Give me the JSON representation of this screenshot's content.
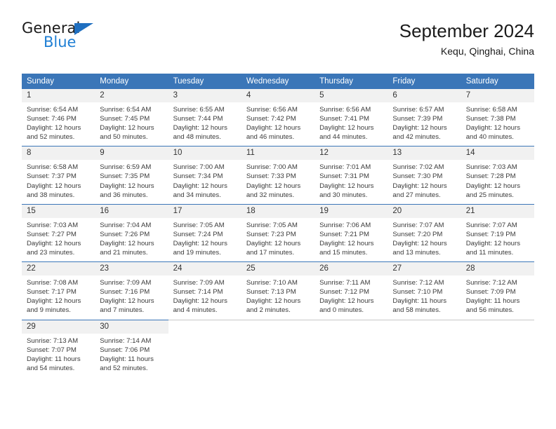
{
  "brand": {
    "name_primary": "General",
    "name_secondary": "Blue",
    "accent_color": "#1f7fd4",
    "triangle_color": "#1f6fc0"
  },
  "header": {
    "title": "September 2024",
    "subtitle": "Kequ, Qinghai, China"
  },
  "calendar": {
    "header_bg": "#3b76b8",
    "daynum_bg": "#f1f1f1",
    "weekday_headers": [
      "Sunday",
      "Monday",
      "Tuesday",
      "Wednesday",
      "Thursday",
      "Friday",
      "Saturday"
    ],
    "weeks": [
      [
        {
          "day": "1",
          "sunrise": "Sunrise: 6:54 AM",
          "sunset": "Sunset: 7:46 PM",
          "daylight_line1": "Daylight: 12 hours",
          "daylight_line2": "and 52 minutes."
        },
        {
          "day": "2",
          "sunrise": "Sunrise: 6:54 AM",
          "sunset": "Sunset: 7:45 PM",
          "daylight_line1": "Daylight: 12 hours",
          "daylight_line2": "and 50 minutes."
        },
        {
          "day": "3",
          "sunrise": "Sunrise: 6:55 AM",
          "sunset": "Sunset: 7:44 PM",
          "daylight_line1": "Daylight: 12 hours",
          "daylight_line2": "and 48 minutes."
        },
        {
          "day": "4",
          "sunrise": "Sunrise: 6:56 AM",
          "sunset": "Sunset: 7:42 PM",
          "daylight_line1": "Daylight: 12 hours",
          "daylight_line2": "and 46 minutes."
        },
        {
          "day": "5",
          "sunrise": "Sunrise: 6:56 AM",
          "sunset": "Sunset: 7:41 PM",
          "daylight_line1": "Daylight: 12 hours",
          "daylight_line2": "and 44 minutes."
        },
        {
          "day": "6",
          "sunrise": "Sunrise: 6:57 AM",
          "sunset": "Sunset: 7:39 PM",
          "daylight_line1": "Daylight: 12 hours",
          "daylight_line2": "and 42 minutes."
        },
        {
          "day": "7",
          "sunrise": "Sunrise: 6:58 AM",
          "sunset": "Sunset: 7:38 PM",
          "daylight_line1": "Daylight: 12 hours",
          "daylight_line2": "and 40 minutes."
        }
      ],
      [
        {
          "day": "8",
          "sunrise": "Sunrise: 6:58 AM",
          "sunset": "Sunset: 7:37 PM",
          "daylight_line1": "Daylight: 12 hours",
          "daylight_line2": "and 38 minutes."
        },
        {
          "day": "9",
          "sunrise": "Sunrise: 6:59 AM",
          "sunset": "Sunset: 7:35 PM",
          "daylight_line1": "Daylight: 12 hours",
          "daylight_line2": "and 36 minutes."
        },
        {
          "day": "10",
          "sunrise": "Sunrise: 7:00 AM",
          "sunset": "Sunset: 7:34 PM",
          "daylight_line1": "Daylight: 12 hours",
          "daylight_line2": "and 34 minutes."
        },
        {
          "day": "11",
          "sunrise": "Sunrise: 7:00 AM",
          "sunset": "Sunset: 7:33 PM",
          "daylight_line1": "Daylight: 12 hours",
          "daylight_line2": "and 32 minutes."
        },
        {
          "day": "12",
          "sunrise": "Sunrise: 7:01 AM",
          "sunset": "Sunset: 7:31 PM",
          "daylight_line1": "Daylight: 12 hours",
          "daylight_line2": "and 30 minutes."
        },
        {
          "day": "13",
          "sunrise": "Sunrise: 7:02 AM",
          "sunset": "Sunset: 7:30 PM",
          "daylight_line1": "Daylight: 12 hours",
          "daylight_line2": "and 27 minutes."
        },
        {
          "day": "14",
          "sunrise": "Sunrise: 7:03 AM",
          "sunset": "Sunset: 7:28 PM",
          "daylight_line1": "Daylight: 12 hours",
          "daylight_line2": "and 25 minutes."
        }
      ],
      [
        {
          "day": "15",
          "sunrise": "Sunrise: 7:03 AM",
          "sunset": "Sunset: 7:27 PM",
          "daylight_line1": "Daylight: 12 hours",
          "daylight_line2": "and 23 minutes."
        },
        {
          "day": "16",
          "sunrise": "Sunrise: 7:04 AM",
          "sunset": "Sunset: 7:26 PM",
          "daylight_line1": "Daylight: 12 hours",
          "daylight_line2": "and 21 minutes."
        },
        {
          "day": "17",
          "sunrise": "Sunrise: 7:05 AM",
          "sunset": "Sunset: 7:24 PM",
          "daylight_line1": "Daylight: 12 hours",
          "daylight_line2": "and 19 minutes."
        },
        {
          "day": "18",
          "sunrise": "Sunrise: 7:05 AM",
          "sunset": "Sunset: 7:23 PM",
          "daylight_line1": "Daylight: 12 hours",
          "daylight_line2": "and 17 minutes."
        },
        {
          "day": "19",
          "sunrise": "Sunrise: 7:06 AM",
          "sunset": "Sunset: 7:21 PM",
          "daylight_line1": "Daylight: 12 hours",
          "daylight_line2": "and 15 minutes."
        },
        {
          "day": "20",
          "sunrise": "Sunrise: 7:07 AM",
          "sunset": "Sunset: 7:20 PM",
          "daylight_line1": "Daylight: 12 hours",
          "daylight_line2": "and 13 minutes."
        },
        {
          "day": "21",
          "sunrise": "Sunrise: 7:07 AM",
          "sunset": "Sunset: 7:19 PM",
          "daylight_line1": "Daylight: 12 hours",
          "daylight_line2": "and 11 minutes."
        }
      ],
      [
        {
          "day": "22",
          "sunrise": "Sunrise: 7:08 AM",
          "sunset": "Sunset: 7:17 PM",
          "daylight_line1": "Daylight: 12 hours",
          "daylight_line2": "and 9 minutes."
        },
        {
          "day": "23",
          "sunrise": "Sunrise: 7:09 AM",
          "sunset": "Sunset: 7:16 PM",
          "daylight_line1": "Daylight: 12 hours",
          "daylight_line2": "and 7 minutes."
        },
        {
          "day": "24",
          "sunrise": "Sunrise: 7:09 AM",
          "sunset": "Sunset: 7:14 PM",
          "daylight_line1": "Daylight: 12 hours",
          "daylight_line2": "and 4 minutes."
        },
        {
          "day": "25",
          "sunrise": "Sunrise: 7:10 AM",
          "sunset": "Sunset: 7:13 PM",
          "daylight_line1": "Daylight: 12 hours",
          "daylight_line2": "and 2 minutes."
        },
        {
          "day": "26",
          "sunrise": "Sunrise: 7:11 AM",
          "sunset": "Sunset: 7:12 PM",
          "daylight_line1": "Daylight: 12 hours",
          "daylight_line2": "and 0 minutes."
        },
        {
          "day": "27",
          "sunrise": "Sunrise: 7:12 AM",
          "sunset": "Sunset: 7:10 PM",
          "daylight_line1": "Daylight: 11 hours",
          "daylight_line2": "and 58 minutes."
        },
        {
          "day": "28",
          "sunrise": "Sunrise: 7:12 AM",
          "sunset": "Sunset: 7:09 PM",
          "daylight_line1": "Daylight: 11 hours",
          "daylight_line2": "and 56 minutes."
        }
      ],
      [
        {
          "day": "29",
          "sunrise": "Sunrise: 7:13 AM",
          "sunset": "Sunset: 7:07 PM",
          "daylight_line1": "Daylight: 11 hours",
          "daylight_line2": "and 54 minutes."
        },
        {
          "day": "30",
          "sunrise": "Sunrise: 7:14 AM",
          "sunset": "Sunset: 7:06 PM",
          "daylight_line1": "Daylight: 11 hours",
          "daylight_line2": "and 52 minutes."
        },
        {
          "day": "",
          "sunrise": "",
          "sunset": "",
          "daylight_line1": "",
          "daylight_line2": ""
        },
        {
          "day": "",
          "sunrise": "",
          "sunset": "",
          "daylight_line1": "",
          "daylight_line2": ""
        },
        {
          "day": "",
          "sunrise": "",
          "sunset": "",
          "daylight_line1": "",
          "daylight_line2": ""
        },
        {
          "day": "",
          "sunrise": "",
          "sunset": "",
          "daylight_line1": "",
          "daylight_line2": ""
        },
        {
          "day": "",
          "sunrise": "",
          "sunset": "",
          "daylight_line1": "",
          "daylight_line2": ""
        }
      ]
    ]
  }
}
